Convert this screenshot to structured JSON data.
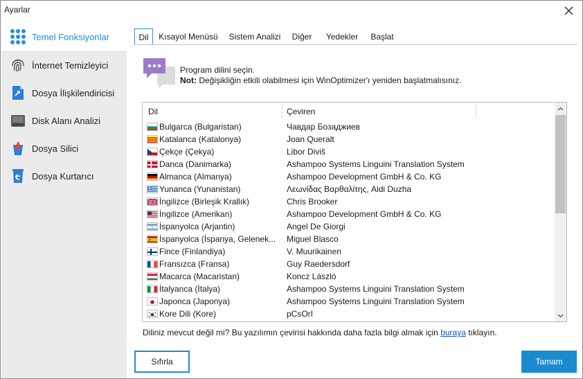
{
  "window": {
    "title": "Ayarlar"
  },
  "sidebar": {
    "items": [
      {
        "label": "Temel Fonksiyonlar",
        "icon": "grid-dots-icon",
        "active": true
      },
      {
        "label": "İnternet Temizleyici",
        "icon": "fingerprint-icon",
        "active": false
      },
      {
        "label": "Dosya İlişkilendiricisi",
        "icon": "file-link-icon",
        "active": false
      },
      {
        "label": "Disk Alanı Analizi",
        "icon": "hard-drive-icon",
        "active": false
      },
      {
        "label": "Dosya Silici",
        "icon": "trash-fire-icon",
        "active": false
      },
      {
        "label": "Dosya Kurtarıcı",
        "icon": "restore-bin-icon",
        "active": false
      }
    ]
  },
  "tabs": [
    {
      "label": "Dil",
      "active": true
    },
    {
      "label": "Kısayol Menüsü",
      "active": false
    },
    {
      "label": "Sistem Analizi",
      "active": false
    },
    {
      "label": "Diğer",
      "active": false
    },
    {
      "label": "Yedekler",
      "active": false
    },
    {
      "label": "Başlat",
      "active": false
    }
  ],
  "info": {
    "line1": "Program dilini seçin.",
    "note_prefix": "Not:",
    "note_text": " Değişikliğin etkili olabilmesi için WinOptimizer'ı yeniden başlatmalısınız."
  },
  "list": {
    "columns": {
      "language": "Dil",
      "translator": "Çeviren"
    },
    "rows": [
      {
        "flag": "bg",
        "language": "Bulgarca (Bulgaristan)",
        "translator": "Чавдар Бозаджиев"
      },
      {
        "flag": "ca",
        "language": "Katalanca (Katalonya)",
        "translator": "Joan Queralt"
      },
      {
        "flag": "cz",
        "language": "Çekçe (Çekya)",
        "translator": "Libor Diviš"
      },
      {
        "flag": "dk",
        "language": "Danca (Danimarka)",
        "translator": "Ashampoo Systems Linguini Translation System"
      },
      {
        "flag": "de",
        "language": "Almanca (Almanya)",
        "translator": "Ashampoo Development GmbH & Co. KG"
      },
      {
        "flag": "gr",
        "language": "Yunanca (Yunanistan)",
        "translator": "Λεωνίδας Βαρθαλίτης, Aldi Duzha"
      },
      {
        "flag": "gb",
        "language": "İngilizce (Birleşik Krallık)",
        "translator": "Chris Brooker"
      },
      {
        "flag": "us",
        "language": "İngilizce (Amerikan)",
        "translator": "Ashampoo Development GmbH & Co. KG"
      },
      {
        "flag": "ar",
        "language": "İspanyolca (Arjantin)",
        "translator": "Angel De Giorgi"
      },
      {
        "flag": "es",
        "language": "İspanyolca (İspanya, Gelenek...",
        "translator": "Miguel Blasco"
      },
      {
        "flag": "fi",
        "language": "Fince (Finlandiya)",
        "translator": "V. Muurikainen"
      },
      {
        "flag": "fr",
        "language": "Fransızca (Fransa)",
        "translator": "Guy Raedersdorf"
      },
      {
        "flag": "hu",
        "language": "Macarca (Macaristan)",
        "translator": "Koncz László"
      },
      {
        "flag": "it",
        "language": "İtalyanca (İtalya)",
        "translator": "Ashampoo Systems Linguini Translation System"
      },
      {
        "flag": "jp",
        "language": "Japonca (Japonya)",
        "translator": "Ashampoo Systems Linguini Translation System"
      },
      {
        "flag": "kr",
        "language": "Kore Dili (Kore)",
        "translator": "pCsOrI"
      }
    ]
  },
  "footer": {
    "note_before": "Diliniz mevcut değil mi? Bu yazılımın çevirisi hakkında daha fazla bilgi almak için ",
    "note_link": "buraya",
    "note_after": " tıklayın."
  },
  "buttons": {
    "reset": "Sıfırla",
    "ok": "Tamam"
  },
  "colors": {
    "accent": "#1e8ad6",
    "ok_button": "#1b8bd0",
    "sidebar_bg": "#ebebeb",
    "link": "#1a4fc4"
  }
}
